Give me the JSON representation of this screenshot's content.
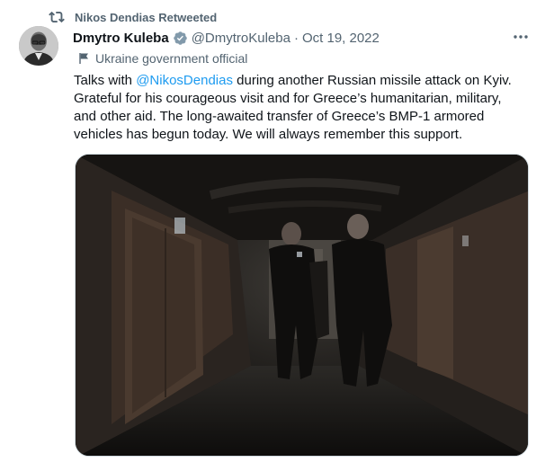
{
  "retweet": {
    "label": "Nikos Dendias Retweeted",
    "icon": "retweet-icon"
  },
  "author": {
    "name": "Dmytro Kuleba",
    "verified_icon": "verified-badge-icon",
    "handle": "@DmytroKuleba",
    "separator": "·",
    "date": "Oct 19, 2022",
    "affiliation": "Ukraine government official",
    "affiliation_icon": "flag-icon"
  },
  "more_icon": "more-icon",
  "tweet": {
    "line1_prefix": "Talks with ",
    "mention": "@NikosDendias",
    "line1_suffix": " during another Russian missile attack on Kyiv.",
    "line2": "Grateful for his courageous visit and for Greece’s humanitarian, military,",
    "line3": "and other aid. The long-awaited transfer of Greece’s BMP-1 armored",
    "line4": "vehicles has begun today. We will always remember this support."
  },
  "colors": {
    "text": "#0f1419",
    "secondary": "#536471",
    "link": "#1d9bf0",
    "border": "#cfd9de"
  }
}
